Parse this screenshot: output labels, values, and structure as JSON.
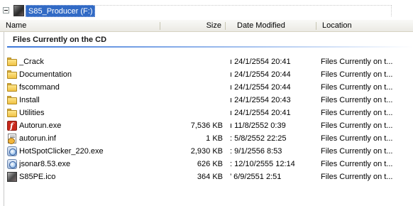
{
  "tree": {
    "drive_label": "S85_Producer (F:)"
  },
  "columns": {
    "name": "Name",
    "size": "Size",
    "date_modified": "Date Modified",
    "location": "Location"
  },
  "group": {
    "heading": "Files Currently on the CD"
  },
  "files": [
    {
      "icon": "folder-icon",
      "name": "_Crack",
      "size": "",
      "date": "ı 24/1/2554 20:41",
      "location": "Files Currently on t..."
    },
    {
      "icon": "folder-icon",
      "name": "Documentation",
      "size": "",
      "date": "ı 24/1/2554 20:44",
      "location": "Files Currently on t..."
    },
    {
      "icon": "folder-icon",
      "name": "fscommand",
      "size": "",
      "date": "ı 24/1/2554 20:44",
      "location": "Files Currently on t..."
    },
    {
      "icon": "folder-icon",
      "name": "Install",
      "size": "",
      "date": "ı 24/1/2554 20:43",
      "location": "Files Currently on t..."
    },
    {
      "icon": "folder-icon",
      "name": "Utilities",
      "size": "",
      "date": "ı 24/1/2554 20:41",
      "location": "Files Currently on t..."
    },
    {
      "icon": "flash-exe-icon",
      "name": "Autorun.exe",
      "size": "7,536 KB",
      "date": "ı 11/8/2552 0:39",
      "location": "Files Currently on t..."
    },
    {
      "icon": "inf-file-icon",
      "name": "autorun.inf",
      "size": "1 KB",
      "date": ": 5/8/2552 22:25",
      "location": "Files Currently on t..."
    },
    {
      "icon": "app-exe-icon",
      "name": "HotSpotClicker_220.exe",
      "size": "2,930 KB",
      "date": ": 9/1/2556 8:53",
      "location": "Files Currently on t..."
    },
    {
      "icon": "app-exe-icon",
      "name": "jsonar8.53.exe",
      "size": "626 KB",
      "date": ": 12/10/2555 12:14",
      "location": "Files Currently on t..."
    },
    {
      "icon": "ico-file-icon",
      "name": "S85PE.ico",
      "size": "364 KB",
      "date": "’ 6/9/2551 2:51",
      "location": "Files Currently on t..."
    }
  ]
}
